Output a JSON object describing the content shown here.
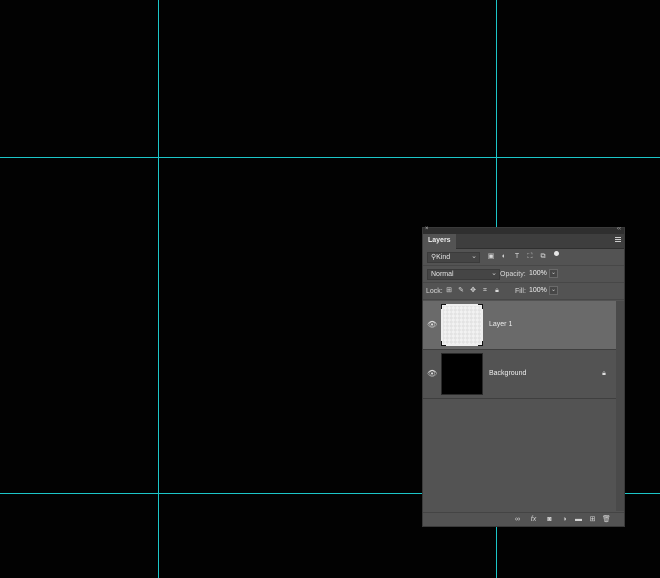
{
  "panel": {
    "close_glyph": "×",
    "collapse_glyph": "‹‹",
    "tab_label": "Layers",
    "menu_icon": "panel-menu-icon"
  },
  "filter": {
    "kind_label": "Kind",
    "icons": [
      "image-filter-icon",
      "adjustment-filter-icon",
      "type-filter-icon",
      "shape-filter-icon",
      "smart-object-filter-icon"
    ]
  },
  "blend": {
    "mode": "Normal",
    "opacity_label": "Opacity:",
    "opacity_value": "100%"
  },
  "lock": {
    "label": "Lock:",
    "fill_label": "Fill:",
    "fill_value": "100%"
  },
  "layers": [
    {
      "name": "Layer 1",
      "selected": true,
      "visible": true,
      "locked": false
    },
    {
      "name": "Background",
      "selected": false,
      "visible": true,
      "locked": true
    }
  ],
  "bottom_icons": [
    "link-layers-icon",
    "fx-icon",
    "add-mask-icon",
    "adjustment-layer-icon",
    "new-group-icon",
    "new-layer-icon",
    "delete-layer-icon"
  ],
  "colors": {
    "guide": "#1cc6c9",
    "panel_bg": "#535353",
    "selected_row": "#6a6a6a"
  }
}
